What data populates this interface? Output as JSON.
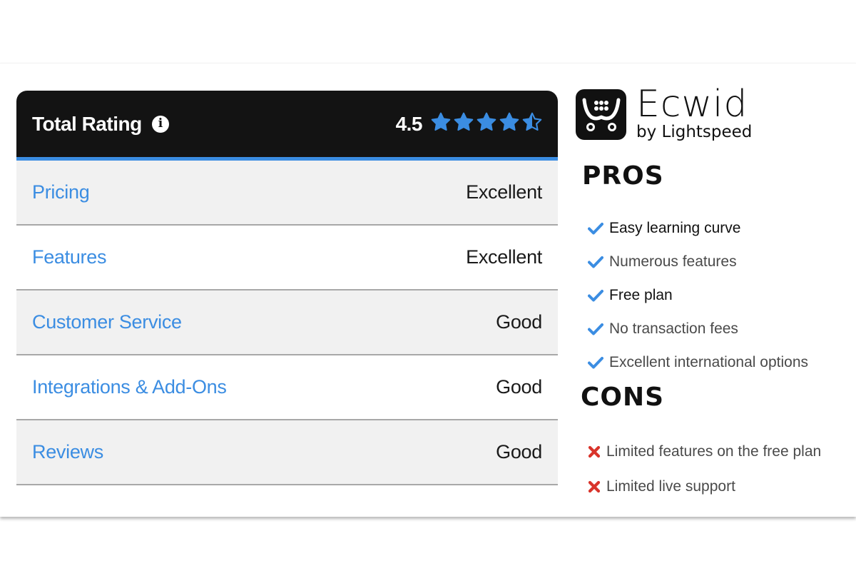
{
  "rating": {
    "title": "Total Rating",
    "info_icon": "info-circle-icon",
    "score": "4.5",
    "stars": {
      "value": 4.5,
      "max": 5
    },
    "accent_color": "#3b8de2",
    "rows": [
      {
        "label": "Pricing",
        "value": "Excellent"
      },
      {
        "label": "Features",
        "value": "Excellent"
      },
      {
        "label": "Customer Service",
        "value": "Good"
      },
      {
        "label": "Integrations & Add-Ons",
        "value": "Good"
      },
      {
        "label": "Reviews",
        "value": "Good"
      }
    ]
  },
  "brand": {
    "logo_icon": "shopping-cart-icon",
    "name": "Ecwid",
    "sub": "by Lightspeed"
  },
  "pros": {
    "title": "PROS",
    "icon": "check-icon",
    "icon_color": "#3b8de2",
    "items": [
      "Easy learning curve",
      "Numerous features",
      "Free plan",
      "No transaction fees",
      "Excellent international options"
    ]
  },
  "cons": {
    "title": "CONS",
    "icon": "x-icon",
    "icon_color": "#d9342b",
    "items": [
      "Limited features on the free plan",
      "Limited live support"
    ]
  }
}
